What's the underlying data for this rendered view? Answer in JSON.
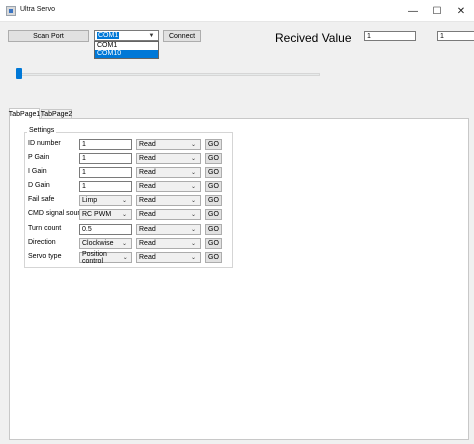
{
  "window": {
    "title": "Ultra Servo",
    "icon": "app-icon",
    "controls": {
      "minimize": "—",
      "maximize": "☐",
      "close": "✕"
    }
  },
  "toolbar": {
    "scan_port_label": "Scan Port",
    "port_selected": "COM1",
    "port_options": [
      "COM1",
      "COM10"
    ],
    "port_highlighted_option": "COM10",
    "connect_label": "Connect",
    "received_label": "Recived Value",
    "received_value_1": "1",
    "received_value_2": "1"
  },
  "slider": {
    "level": 0.0
  },
  "tabs": [
    {
      "label": "TabPage1",
      "active": true
    },
    {
      "label": "TabPage2",
      "active": false
    }
  ],
  "settings": {
    "group_title": "Settings",
    "go_label": "GO",
    "rows": [
      {
        "label": "ID number",
        "field_type": "input",
        "value": "1",
        "mode": "Read"
      },
      {
        "label": "P Gain",
        "field_type": "input",
        "value": "1",
        "mode": "Read"
      },
      {
        "label": "I Gain",
        "field_type": "input",
        "value": "1",
        "mode": "Read"
      },
      {
        "label": "D Gain",
        "field_type": "input",
        "value": "1",
        "mode": "Read"
      },
      {
        "label": "Fail safe",
        "field_type": "select",
        "value": "Limp",
        "mode": "Read"
      },
      {
        "label": "CMD signal source",
        "field_type": "select",
        "value": "RC PWM",
        "mode": "Read"
      },
      {
        "label": "Turn count",
        "field_type": "input",
        "value": "0.5",
        "mode": "Read"
      },
      {
        "label": "Direction",
        "field_type": "select",
        "value": "Clockwise",
        "mode": "Read"
      },
      {
        "label": "Servo type",
        "field_type": "select",
        "value": "Position control",
        "mode": "Read"
      }
    ]
  },
  "colors": {
    "accent": "#0078d7",
    "window_bg": "#f0f0f0",
    "panel_bg": "#ffffff"
  }
}
